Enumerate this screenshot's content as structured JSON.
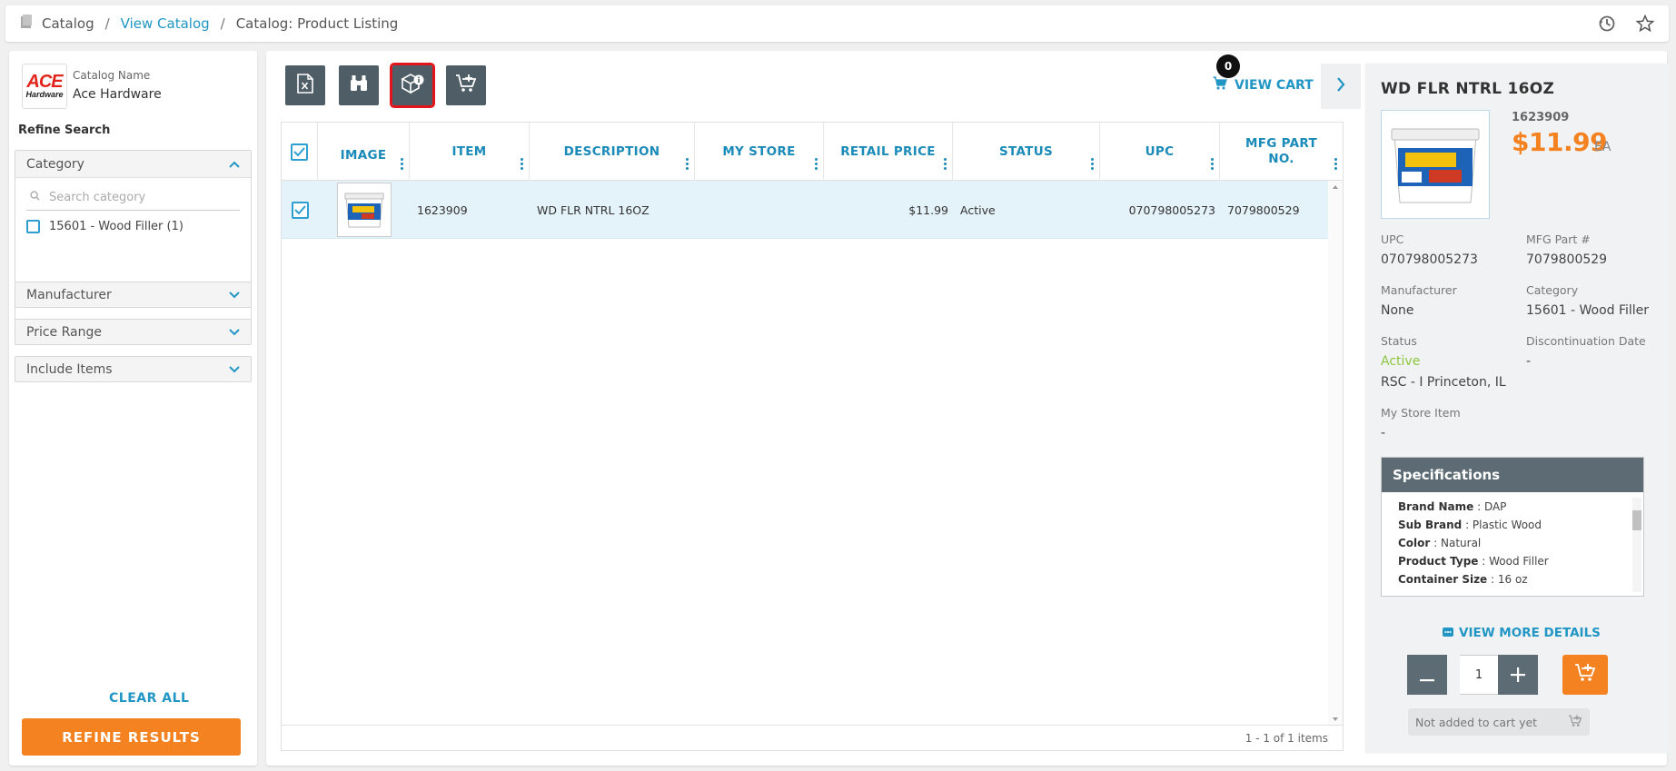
{
  "breadcrumb": {
    "root": "Catalog",
    "link": "View Catalog",
    "current": "Catalog: Product Listing"
  },
  "sidebar": {
    "brand_logo_text": "ACE",
    "brand_logo_sub": "Hardware",
    "catalog_name_label": "Catalog Name",
    "catalog_name": "Ace Hardware",
    "refine_label": "Refine Search",
    "category": {
      "title": "Category",
      "search_placeholder": "Search category",
      "items": [
        {
          "label": "15601 - Wood Filler (1)",
          "checked": false
        }
      ]
    },
    "filters": [
      "Manufacturer",
      "Price Range",
      "Include Items"
    ],
    "clear_all": "CLEAR ALL",
    "refine_button": "REFINE RESULTS"
  },
  "toolbar": {
    "buttons": [
      "export-excel",
      "binoculars",
      "package-info",
      "add-to-cart"
    ],
    "active": "package-info",
    "view_cart": "VIEW CART",
    "cart_count": "0"
  },
  "grid": {
    "columns": [
      "IMAGE",
      "ITEM",
      "DESCRIPTION",
      "MY STORE",
      "RETAIL PRICE",
      "STATUS",
      "UPC",
      "MFG PART NO."
    ],
    "rows": [
      {
        "checked": true,
        "item": "1623909",
        "description": "WD FLR NTRL 16OZ",
        "my_store": "",
        "retail_price": "$11.99",
        "status": "Active",
        "upc": "070798005273",
        "mfg_part": "7079800529"
      }
    ],
    "footer": "1 - 1 of 1 items"
  },
  "detail": {
    "title": "WD FLR NTRL 16OZ",
    "item_number": "1623909",
    "price": "$11.99",
    "unit": "EA",
    "upc_label": "UPC",
    "upc": "070798005273",
    "mfg_label": "MFG Part #",
    "mfg": "7079800529",
    "manufacturer_label": "Manufacturer",
    "manufacturer": "None",
    "category_label": "Category",
    "category": "15601 - Wood Filler",
    "status_label": "Status",
    "status": "Active",
    "disc_label": "Discontinuation Date",
    "disc": "-",
    "rsc": "RSC - I Princeton, IL",
    "my_store_label": "My Store Item",
    "my_store": "-",
    "specs_title": "Specifications",
    "specs": [
      {
        "k": "Brand Name",
        "v": "DAP"
      },
      {
        "k": "Sub Brand",
        "v": "Plastic Wood"
      },
      {
        "k": "Color",
        "v": "Natural"
      },
      {
        "k": "Product Type",
        "v": "Wood Filler"
      },
      {
        "k": "Container Size",
        "v": "16 oz"
      }
    ],
    "view_more": "VIEW MORE DETAILS",
    "qty": "1",
    "not_added": "Not added to cart yet",
    "status_color": "#8cc63f",
    "accent": "#f58220"
  }
}
